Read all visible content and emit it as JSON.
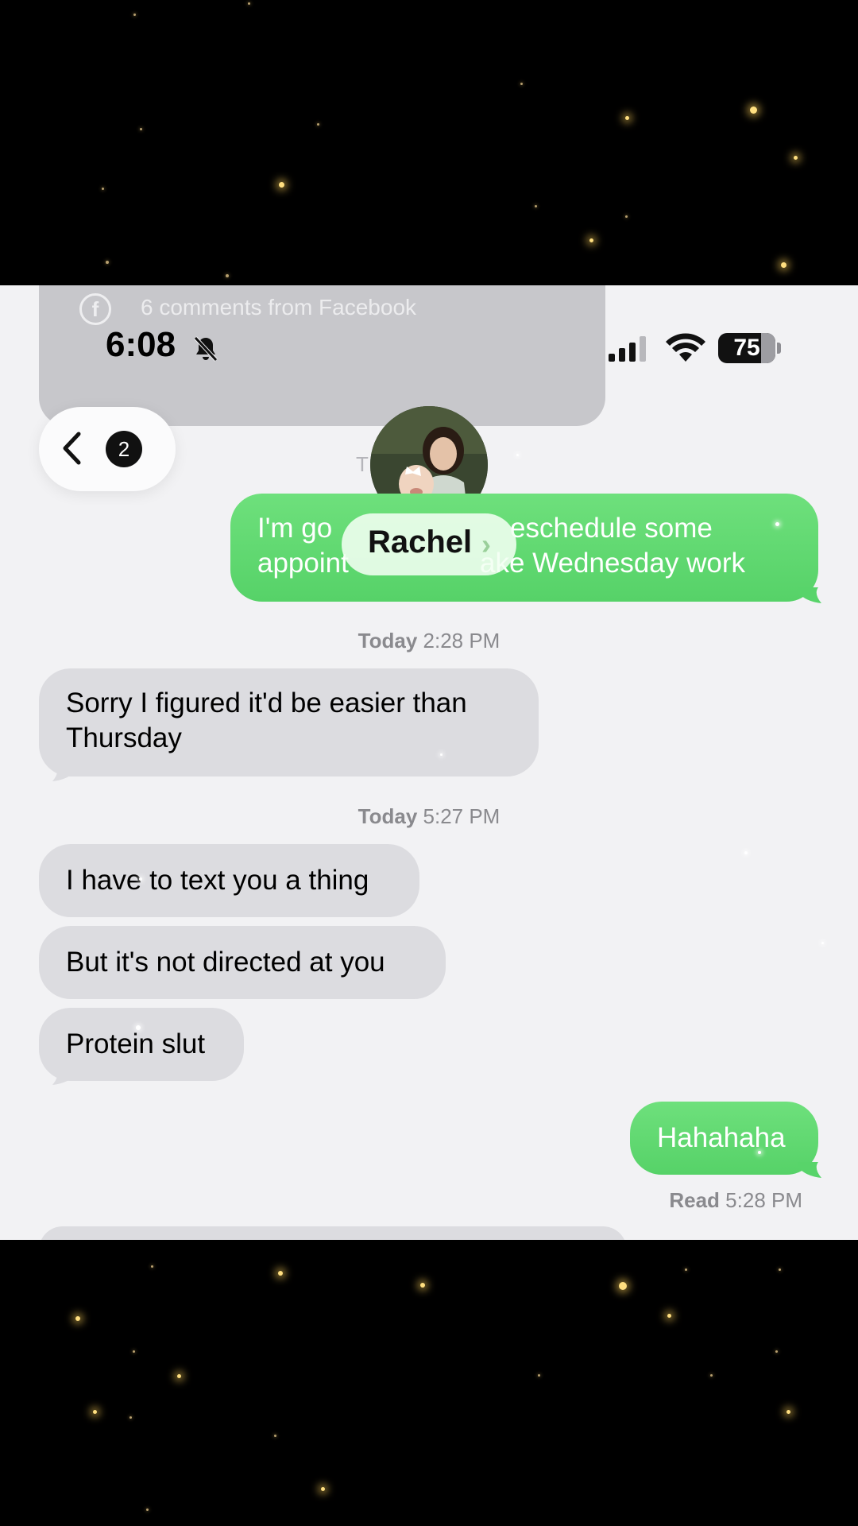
{
  "notification": {
    "icon": "facebook-icon",
    "text": "6 comments from Facebook"
  },
  "status_bar": {
    "time": "6:08",
    "battery": "75",
    "silent_icon": "bell-slash-icon",
    "signal_icon": "cellular-signal-icon",
    "wifi_icon": "wifi-icon"
  },
  "nav": {
    "back_icon": "chevron-left-icon",
    "unread_count": "2",
    "contact_name": "Rachel",
    "contact_chevron": "›",
    "ghost_timestamp": "T                  M"
  },
  "messages": [
    {
      "type": "out",
      "text": "I'm going to try and reschedule some appointments to make Wednesday work",
      "visible_lines": [
        "I'm go",
        "appoint",
        "eschedule some",
        "ake Wednesday work"
      ]
    },
    {
      "type": "timestamp",
      "day": "Today",
      "time": "2:28 PM"
    },
    {
      "type": "in",
      "text": "Sorry I figured it'd be easier than Thursday"
    },
    {
      "type": "timestamp",
      "day": "Today",
      "time": "5:27 PM"
    },
    {
      "type": "in",
      "text": "I have to text you a thing"
    },
    {
      "type": "in",
      "text": "But it's not directed at you"
    },
    {
      "type": "in",
      "text": "Protein slut"
    },
    {
      "type": "out",
      "text": "Hahahaha"
    },
    {
      "type": "receipt",
      "label": "Read",
      "time": "5:28 PM"
    }
  ],
  "colors": {
    "sent_bubble": "#5ad66b",
    "received_bubble": "#dcdce0",
    "background": "#f2f2f4",
    "overlay": "#000000",
    "sparkle": "#ffdf80"
  }
}
